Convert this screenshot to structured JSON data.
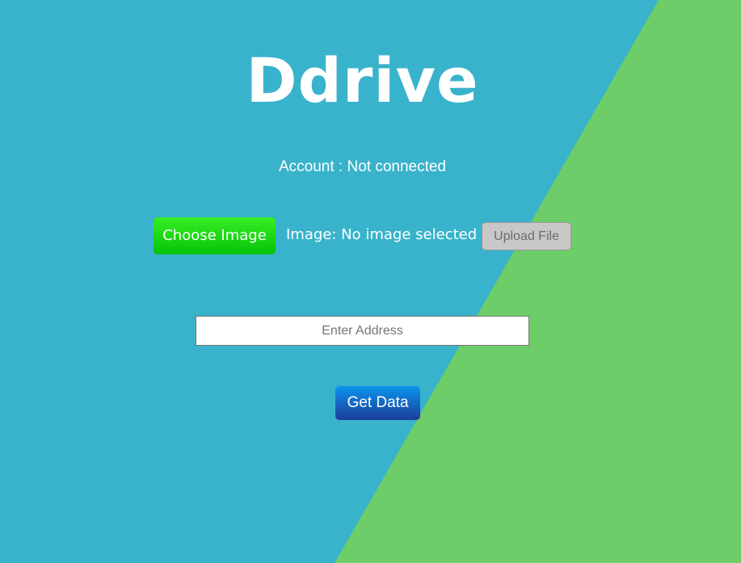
{
  "app": {
    "title": "Ddrive"
  },
  "account": {
    "status_text": "Account : Not connected"
  },
  "upload": {
    "choose_label": "Choose Image",
    "image_status": "Image: No image selected",
    "upload_label": "Upload File"
  },
  "address": {
    "placeholder": "Enter Address",
    "value": ""
  },
  "actions": {
    "get_data_label": "Get Data"
  },
  "colors": {
    "background_blue": "#38b3cb",
    "background_green": "#6dcd68",
    "choose_button": "#1dd816",
    "get_data_button": "#1565c0",
    "upload_button": "#c8c8c8"
  }
}
